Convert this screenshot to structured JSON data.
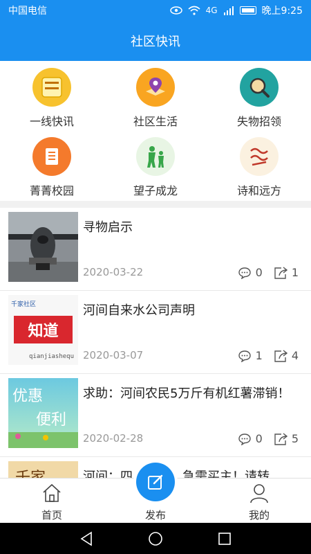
{
  "status": {
    "carrier": "中国电信",
    "network": "4G",
    "time": "晚上9:25"
  },
  "header": {
    "title": "社区快讯"
  },
  "grid": [
    {
      "label": "一线快讯",
      "icon": "yixian-kuaixun-icon",
      "color": "#f7c22e"
    },
    {
      "label": "社区生活",
      "icon": "map-pin-icon",
      "color": "#f9a521"
    },
    {
      "label": "失物招领",
      "icon": "magnifier-icon",
      "color": "#22a3a0"
    },
    {
      "label": "菁菁校园",
      "icon": "document-icon",
      "color": "#f47a2c"
    },
    {
      "label": "望子成龙",
      "icon": "parent-child-icon",
      "color": "#38a64a"
    },
    {
      "label": "诗和远方",
      "icon": "poetry-icon",
      "color": "#c0392b"
    }
  ],
  "news": [
    {
      "title": "寻物启示",
      "date": "2020-03-22",
      "comments": "0",
      "shares": "1",
      "thumb": "airplane"
    },
    {
      "title": "河间自来水公司声明",
      "date": "2020-03-07",
      "comments": "1",
      "shares": "4",
      "thumb": "zhidao",
      "thumb_top": "千家社区",
      "thumb_main": "知道",
      "thumb_bottom": "qianjiashequ"
    },
    {
      "title": "求助：河间农民5万斤有机红薯滞销！",
      "date": "2020-02-28",
      "comments": "0",
      "shares": "5",
      "thumb": "youhui",
      "thumb_line1": "优惠",
      "thumb_line2": "便利"
    },
    {
      "title": "河间：四……葱，急需买主！请转",
      "date": "",
      "comments": "",
      "shares": "",
      "thumb": "partial",
      "thumb_text": "千家"
    }
  ],
  "tabs": [
    {
      "label": "首页",
      "icon": "home-icon"
    },
    {
      "label": "发布",
      "icon": "edit-icon"
    },
    {
      "label": "我的",
      "icon": "user-icon"
    }
  ],
  "colors": {
    "primary": "#1a8ff0"
  }
}
